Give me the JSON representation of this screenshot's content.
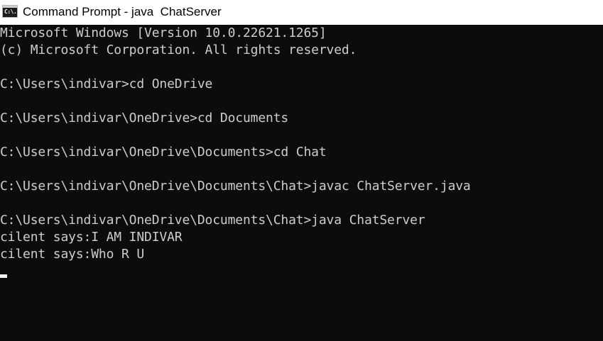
{
  "window": {
    "title": "Command Prompt - java  ChatServer",
    "icon": "cmd-icon",
    "icon_text": "C:\\."
  },
  "console": {
    "lines": [
      "Microsoft Windows [Version 10.0.22621.1265]",
      "(c) Microsoft Corporation. All rights reserved.",
      "",
      "C:\\Users\\indivar>cd OneDrive",
      "",
      "C:\\Users\\indivar\\OneDrive>cd Documents",
      "",
      "C:\\Users\\indivar\\OneDrive\\Documents>cd Chat",
      "",
      "C:\\Users\\indivar\\OneDrive\\Documents\\Chat>javac ChatServer.java",
      "",
      "C:\\Users\\indivar\\OneDrive\\Documents\\Chat>java ChatServer",
      "cilent says:I AM INDIVAR",
      "cilent says:Who R U"
    ]
  },
  "colors": {
    "background": "#0c0c0c",
    "text": "#cccccc",
    "titlebar": "#ffffff",
    "cursor": "#f2f2f2"
  }
}
